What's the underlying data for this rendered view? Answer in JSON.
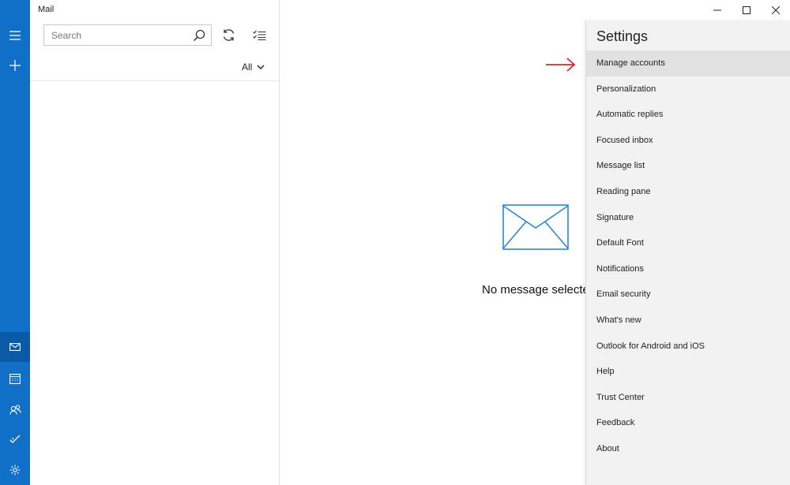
{
  "app": {
    "title": "Mail"
  },
  "rail": {
    "items": [
      {
        "name": "hamburger-menu-icon"
      },
      {
        "name": "new-mail-icon"
      },
      {
        "name": "mail-icon"
      },
      {
        "name": "calendar-icon"
      },
      {
        "name": "people-icon"
      },
      {
        "name": "todo-icon"
      },
      {
        "name": "settings-gear-icon"
      }
    ],
    "accent": "#1070c8"
  },
  "list": {
    "search_placeholder": "Search",
    "filter_label": "All"
  },
  "reading": {
    "empty_text": "No message selected"
  },
  "settings": {
    "title": "Settings",
    "items": [
      {
        "label": "Manage accounts",
        "selected": true
      },
      {
        "label": "Personalization"
      },
      {
        "label": "Automatic replies"
      },
      {
        "label": "Focused inbox"
      },
      {
        "label": "Message list"
      },
      {
        "label": "Reading pane"
      },
      {
        "label": "Signature"
      },
      {
        "label": "Default Font"
      },
      {
        "label": "Notifications"
      },
      {
        "label": "Email security"
      },
      {
        "label": "What's new"
      },
      {
        "label": "Outlook for Android and iOS"
      },
      {
        "label": "Help"
      },
      {
        "label": "Trust Center"
      },
      {
        "label": "Feedback"
      },
      {
        "label": "About"
      }
    ]
  },
  "annotation": {
    "color": "#e0262b"
  }
}
